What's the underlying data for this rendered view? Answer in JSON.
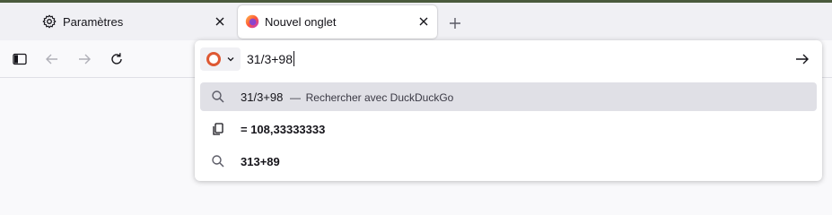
{
  "tabs": [
    {
      "label": "Paramètres",
      "icon": "gear-icon"
    },
    {
      "label": "Nouvel onglet",
      "icon": "firefox-icon"
    }
  ],
  "urlbar": {
    "value": "31/3+98",
    "engine_icon": "duckduckgo-icon"
  },
  "results": [
    {
      "query": "31/3+98",
      "separator": "—",
      "action": "Rechercher avec DuckDuckGo",
      "icon": "search-icon"
    },
    {
      "text": "= 108,33333333",
      "icon": "copy-icon"
    },
    {
      "text": "313+89",
      "icon": "search-icon"
    }
  ],
  "colors": {
    "accent": "#de5833",
    "selected_row": "#e0e0e6",
    "tabbar": "#f0f0f4"
  }
}
